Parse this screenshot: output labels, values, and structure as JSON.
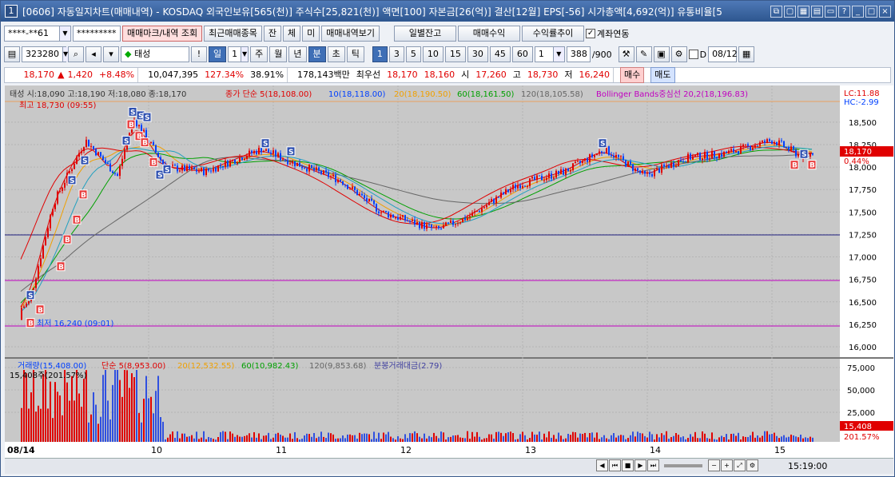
{
  "titlebar": {
    "num": "1",
    "text": "[0606] 자동일지차트(매매내역) - KOSDAQ 외국인보유[565(천)] 주식수[25,821(천)] 액면[100] 자본금[26(억)] 결산[12월] EPS[-56] 시가총액[4,692(억)] 유통비율[5"
  },
  "row1": {
    "account": "****-**61",
    "password": "*********",
    "btn_mark": "매매마크/내역 조회",
    "btn_recent": "최근매매종목",
    "btn_jan": "잔",
    "btn_che": "체",
    "btn_mi": "미",
    "btn_history": "매매내역보기",
    "btn_daily": "일별잔고",
    "btn_profit": "매매수익",
    "btn_return": "수익률추이",
    "chk_account": "계좌연동"
  },
  "row2": {
    "code": "323280",
    "name": "태성",
    "periods": [
      "일",
      "주",
      "월",
      "년",
      "분",
      "초",
      "틱"
    ],
    "selected_period": "분",
    "day_count": "1",
    "minutes": [
      "1",
      "3",
      "5",
      "10",
      "15",
      "30",
      "45",
      "60"
    ],
    "selected_minute": "1",
    "unit": "1",
    "count": "388",
    "total": "/900",
    "d_label": "D",
    "date": "08/12"
  },
  "row3": {
    "price": "18,170",
    "arrow": "▲",
    "change": "1,420",
    "rate": "+8.48%",
    "volume": "10,047,395",
    "vol_ratio": "127.34%",
    "turnover": "38.91%",
    "amount": "178,143백만",
    "best_label": "최우선",
    "ask": "18,170",
    "bid": "18,160",
    "open_label": "시",
    "open": "17,260",
    "high_label": "고",
    "high": "18,730",
    "low_label": "저",
    "low": "16,240",
    "buy": "매수",
    "sell": "매도"
  },
  "chart": {
    "legend_main": "태성 시:18,090 고:18,190 저:18,080 종:18,170",
    "legend_close": "종가 단순 5(18,108.00)",
    "legend_ma10": "10(18,118.00)",
    "legend_ma20": "20(18,190.50)",
    "legend_ma60": "60(18,161.50)",
    "legend_ma120": "120(18,105.58)",
    "legend_bb": "Bollinger Bands중심선 20,2(18,196.83)",
    "lc": "LC:11.88",
    "hc": "HC:-2.99",
    "high_note": "최고 18,730 (09:55)",
    "low_note": "최저 16,240 (09:01)",
    "price_ticks": [
      "18,500",
      "18,250",
      "18,000",
      "17,750",
      "17,500",
      "17,250",
      "17,000",
      "16,750",
      "16,500",
      "16,250",
      "16,000"
    ],
    "cur_price": "18,170",
    "cur_pct": "0.44%",
    "vol_legend": "거래량(15,408.00)",
    "vol_ma5": "단순 5(8,953.00)",
    "vol_ma20": "20(12,532.55)",
    "vol_ma60": "60(10,982.43)",
    "vol_ma120": "120(9,853.68)",
    "vol_amt": "분봉거래대금(2.79)",
    "vol_cur": "15,408주(201.57%)",
    "vol_ticks": [
      "75,000",
      "50,000",
      "25,000"
    ],
    "vol_tag1": "15,408",
    "vol_tag2": "201.57%",
    "x_labels": [
      "08/14",
      "10",
      "11",
      "12",
      "13",
      "14",
      "15"
    ],
    "time": "15:19:00"
  },
  "colors": {
    "up": "#e00000",
    "down": "#0040ff",
    "bg": "#c8c8c8",
    "ma5": "#e00000",
    "ma20": "#f0a000",
    "ma60": "#00a000",
    "ma120": "#666666",
    "bb": "#c000c0"
  }
}
